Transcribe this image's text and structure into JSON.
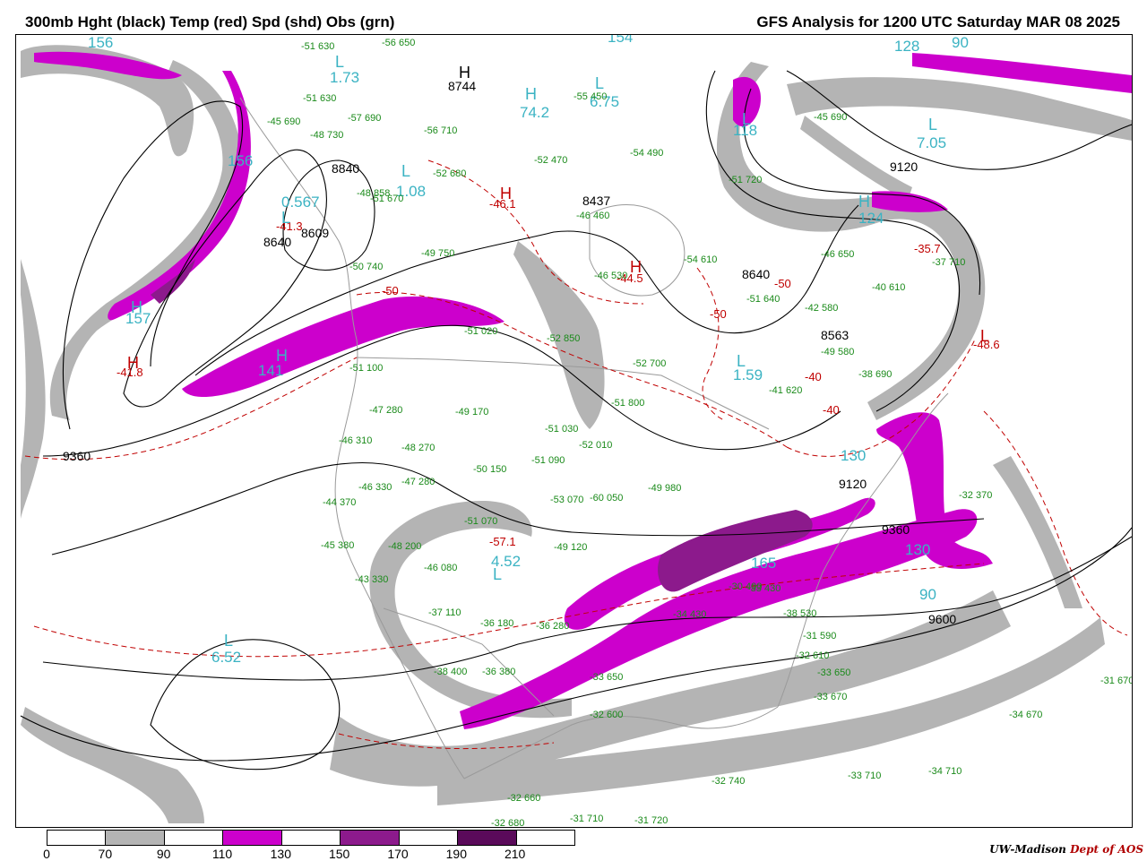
{
  "header": {
    "title_left": "300mb Hght (black) Temp (red) Spd (shd) Obs (grn)",
    "title_right": "GFS Analysis for 1200 UTC Saturday  MAR 08 2025"
  },
  "colors": {
    "height_contour": "#000000",
    "temperature_contour": "#c00000",
    "speed_label": "#3bb3c3",
    "observation": "#1a8a1a",
    "geography": "#9a9a9a",
    "speed_70_90": "#b4b4b4",
    "speed_110_130": "#cc00cc",
    "speed_150_170": "#8c1a8c",
    "speed_190_210": "#5a0a5a"
  },
  "legend": {
    "labels": [
      "0",
      "70",
      "90",
      "110",
      "130",
      "150",
      "170",
      "190",
      "210"
    ],
    "segments": [
      "#ffffff",
      "#b4b4b4",
      "#ffffff",
      "#cc00cc",
      "#ffffff",
      "#8c1a8c",
      "#ffffff",
      "#5a0a5a",
      "#ffffff"
    ]
  },
  "credit": {
    "org": "UW-Madison",
    "dept": "Dept of AOS"
  },
  "map": {
    "height_labels": [
      "8744",
      "8840",
      "8640",
      "8609",
      "8437",
      "8640",
      "8563",
      "9120",
      "9360",
      "9120",
      "9360",
      "9600"
    ],
    "temp_labels": [
      "-41.3",
      "-41.8",
      "-46.1",
      "-44.5",
      "-35.7",
      "-48.6",
      "-57.1",
      "-50",
      "-50",
      "-50",
      "-40",
      "-40"
    ],
    "speed_labels": [
      "156",
      "156",
      "1.73",
      "0.567",
      "1.08",
      "74.2",
      "6.75",
      "154",
      "128",
      "90",
      "7.05",
      "118",
      "124",
      "1.59",
      "157",
      "141",
      "130",
      "130",
      "165",
      "4.52",
      "90",
      "6.52"
    ],
    "centers": [
      "H",
      "H",
      "H",
      "H",
      "H",
      "H",
      "H",
      "H",
      "L",
      "L",
      "L",
      "L",
      "L",
      "L",
      "L",
      "L",
      "L",
      "L"
    ],
    "observations": [
      "-51 630",
      "-56 650",
      "-51 630",
      "-57 690",
      "-45 690",
      "-48 730",
      "-48 858",
      "-51 670",
      "-56 710",
      "-52 680",
      "-52 470",
      "-55 450",
      "-54 490",
      "-46 460",
      "-45 690",
      "-51 720",
      "-50 740",
      "-49 750",
      "-46 530",
      "-54 610",
      "-51 640",
      "-46 650",
      "-37 710",
      "-40 610",
      "-42 580",
      "-49 580",
      "-38 690",
      "-41 620",
      "-52 850",
      "-52 700",
      "-51 020",
      "-51 800",
      "-51 100",
      "-49 170",
      "-47 280",
      "-46 310",
      "-48 270",
      "-50 150",
      "-51 090",
      "-51 030",
      "-52 010",
      "-46 330",
      "-47 280",
      "-44 370",
      "-45 380",
      "-43 330",
      "-48 200",
      "-46 080",
      "-51 070",
      "-49 120",
      "-53 070",
      "-60 050",
      "-49 980",
      "-37 110",
      "-36 180",
      "-36 280",
      "-38 400",
      "-36 380",
      "-34 430",
      "-30 400",
      "-33 430",
      "-38 530",
      "-31 590",
      "-32 610",
      "-33 650",
      "-33 670",
      "-32 740",
      "-33 710",
      "-34 710",
      "-32 660",
      "-32 680",
      "-31 710",
      "-31 720",
      "-32 600",
      "-33 650",
      "-31 670",
      "-34 670",
      "-32 370"
    ]
  }
}
